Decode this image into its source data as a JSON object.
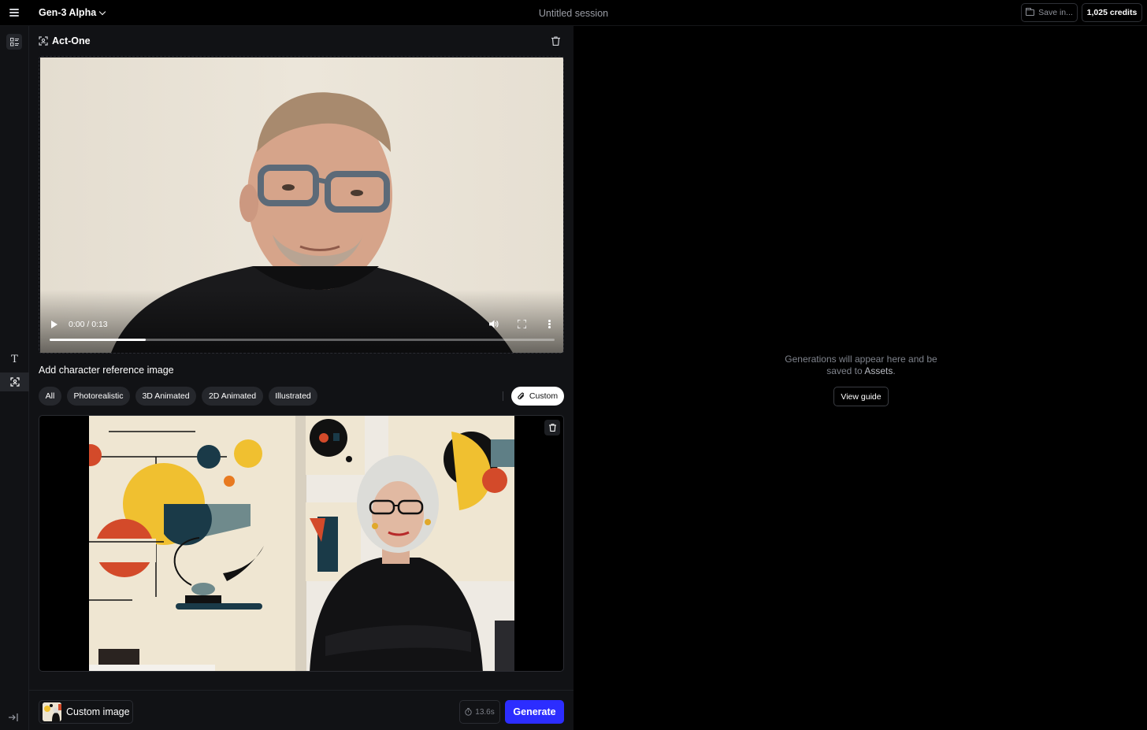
{
  "header": {
    "model_label": "Gen-3 Alpha",
    "session_title": "Untitled session",
    "save_label": "Save in...",
    "credits_label": "1,025 credits"
  },
  "rail": {
    "items": [
      "layout-icon",
      "text-tool-icon",
      "face-scan-icon",
      "collapse-icon"
    ]
  },
  "panel": {
    "title": "Act-One",
    "video": {
      "time": "0:00 / 0:13",
      "progress": 0.19
    },
    "reference_label": "Add character reference image",
    "filters": [
      "All",
      "Photorealistic",
      "3D Animated",
      "2D Animated",
      "Illustrated"
    ],
    "custom_label": "Custom",
    "footer": {
      "custom_image_label": "Custom image",
      "duration": "13.6s",
      "generate_label": "Generate"
    }
  },
  "output": {
    "empty_line1": "Generations will appear here and be",
    "empty_line2_prefix": "saved to ",
    "empty_link": "Assets",
    "empty_suffix": ".",
    "view_guide_label": "View guide"
  },
  "colors": {
    "accent": "#2c2dff",
    "panel_bg": "#111215",
    "page_bg": "#000000"
  }
}
